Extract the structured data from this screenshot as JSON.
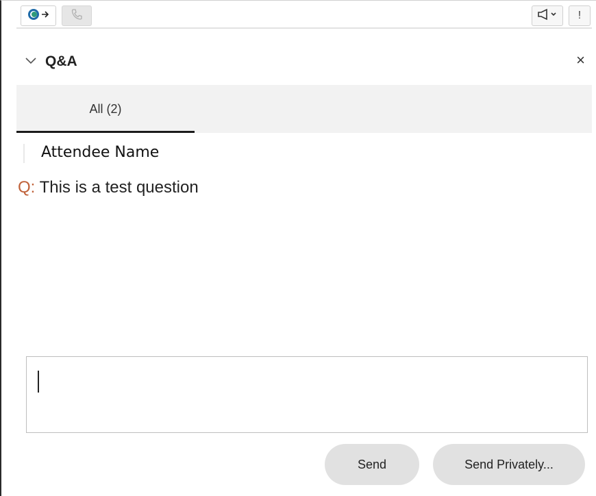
{
  "toolbar": {
    "status_icon": "connected-status-icon",
    "phone_icon": "phone-icon",
    "announce_icon": "megaphone-icon",
    "more_label": "!"
  },
  "panel": {
    "title": "Q&A",
    "close_label": "×"
  },
  "tabs": [
    {
      "label": "All (2)",
      "selected": true
    }
  ],
  "message": {
    "author": "Attendee Name",
    "prefix": "Q:",
    "text": " This is a test question"
  },
  "composer": {
    "value": "",
    "placeholder": ""
  },
  "buttons": {
    "send": "Send",
    "send_privately": "Send Privately..."
  },
  "colors": {
    "question_prefix": "#c0623a",
    "tab_underline": "#1a1a1a",
    "button_bg": "#e1e1e1"
  }
}
